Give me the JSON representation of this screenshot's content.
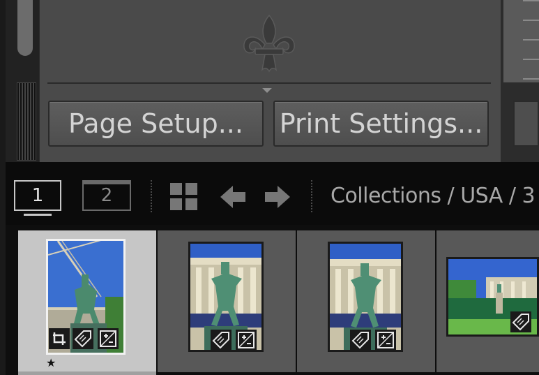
{
  "panel": {
    "ornament_icon": "fleur-de-lis-icon",
    "page_setup_label": "Page Setup...",
    "print_settings_label": "Print Settings..."
  },
  "toolbar": {
    "screen_1_label": "1",
    "screen_2_label": "2",
    "grid_icon": "grid-view-icon",
    "back_icon": "back-arrow-icon",
    "forward_icon": "forward-arrow-icon",
    "breadcrumb": "Collections / USA / 3"
  },
  "filmstrip": {
    "items": [
      {
        "selected": true,
        "badges": [
          "crop-icon",
          "keyword-tag-icon",
          "develop-adjust-icon"
        ],
        "rating": "★"
      },
      {
        "selected": false,
        "badges": [
          "keyword-tag-icon",
          "develop-adjust-icon"
        ]
      },
      {
        "selected": false,
        "badges": [
          "keyword-tag-icon",
          "develop-adjust-icon"
        ]
      },
      {
        "selected": false,
        "badges": [
          "keyword-tag-icon"
        ]
      }
    ]
  },
  "colors": {
    "panel_bg": "#4a4a4a",
    "toolbar_bg": "#0b0b0b",
    "selected_cell": "#c6c6c6",
    "cell_bg": "#585858"
  }
}
